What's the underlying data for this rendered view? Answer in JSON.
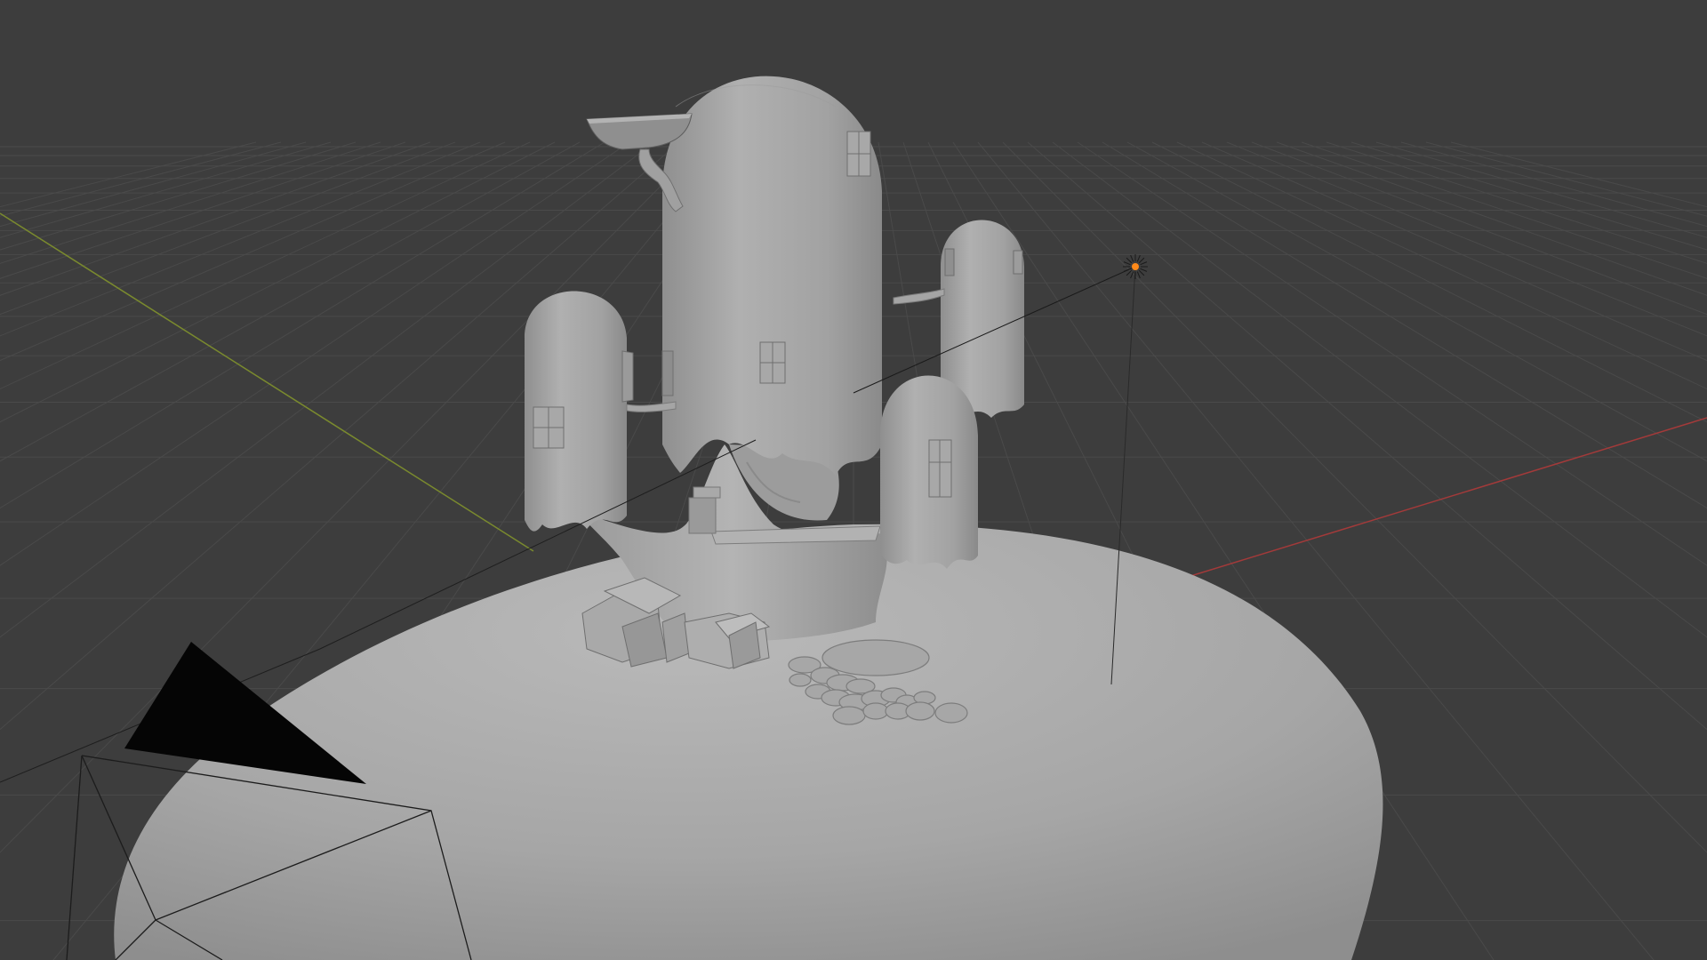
{
  "viewport": {
    "mode": "solid-shading",
    "colors": {
      "background": "#3d3d3d",
      "grid": "#4a4a4a",
      "x_axis": "#a33a3a",
      "y_axis": "#7a8a2e",
      "mesh": "#a3a3a3",
      "light_dot": "#ff8a1a"
    }
  },
  "scene": {
    "objects": [
      "terrain-dome",
      "tree-trunk",
      "main-pod",
      "left-pod",
      "right-back-pod",
      "right-front-pod",
      "top-balcony",
      "side-buildings",
      "stepping-stones",
      "point-light",
      "camera"
    ]
  }
}
